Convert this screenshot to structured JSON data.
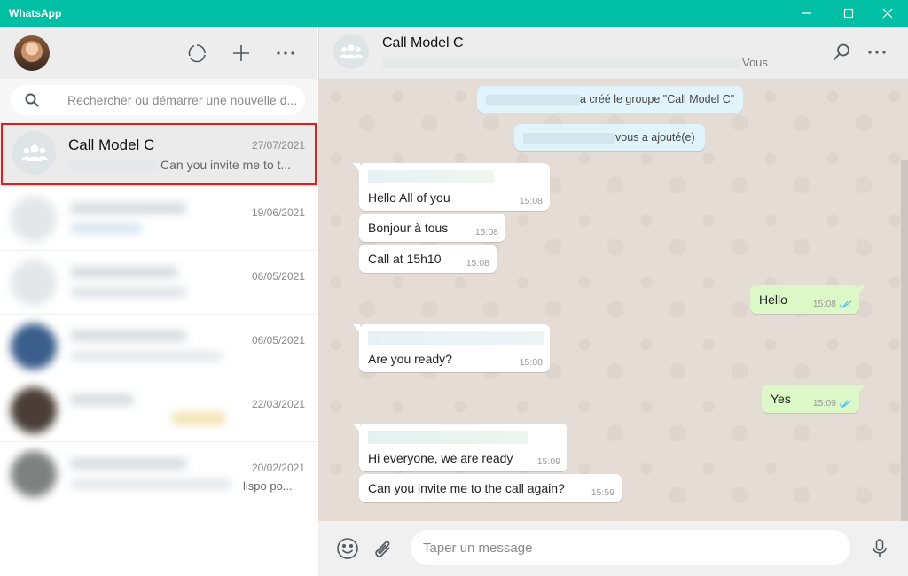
{
  "window": {
    "title": "WhatsApp"
  },
  "sidebar": {
    "search_placeholder": "Rechercher ou démarrer une nouvelle d...",
    "chats": [
      {
        "name": "Call Model C",
        "date": "27/07/2021",
        "preview": "Can you invite me to t...",
        "selected": true
      },
      {
        "date": "19/06/2021"
      },
      {
        "date": "06/05/2021"
      },
      {
        "date": "06/05/2021"
      },
      {
        "date": "22/03/2021"
      },
      {
        "date": "20/02/2021",
        "preview_tail": "lispo po..."
      }
    ]
  },
  "conversation": {
    "title": "Call Model C",
    "subtitle_suffix": "Vous",
    "system_messages": [
      "a créé le groupe \"Call Model C\"",
      "vous a ajouté(e)"
    ],
    "messages": [
      {
        "direction": "in",
        "text": "Hello All of you",
        "time": "15:08"
      },
      {
        "direction": "in",
        "text": "Bonjour à tous",
        "time": "15:08"
      },
      {
        "direction": "in",
        "text": "Call at 15h10",
        "time": "15:08"
      },
      {
        "direction": "out",
        "text": "Hello",
        "time": "15:08"
      },
      {
        "direction": "in",
        "text": "Are you ready?",
        "time": "15:08"
      },
      {
        "direction": "out",
        "text": "Yes",
        "time": "15:09"
      },
      {
        "direction": "in",
        "text": "Hi everyone, we are ready",
        "time": "15:09"
      },
      {
        "direction": "in",
        "text": "Can you invite me to the call again?",
        "time": "15:59"
      }
    ],
    "composer_placeholder": "Taper un message"
  },
  "colors": {
    "titlebar": "#00bfa5",
    "outgoing_bubble": "#dcf8c6",
    "incoming_bubble": "#ffffff",
    "read_ticks": "#4fc3f7",
    "highlight": "#e31b1b"
  },
  "icons": [
    "minimize-icon",
    "maximize-icon",
    "close-icon",
    "status-icon",
    "new-chat-icon",
    "menu-icon",
    "search-icon",
    "group-icon",
    "emoji-icon",
    "attach-icon",
    "microphone-icon",
    "read-ticks-icon"
  ]
}
